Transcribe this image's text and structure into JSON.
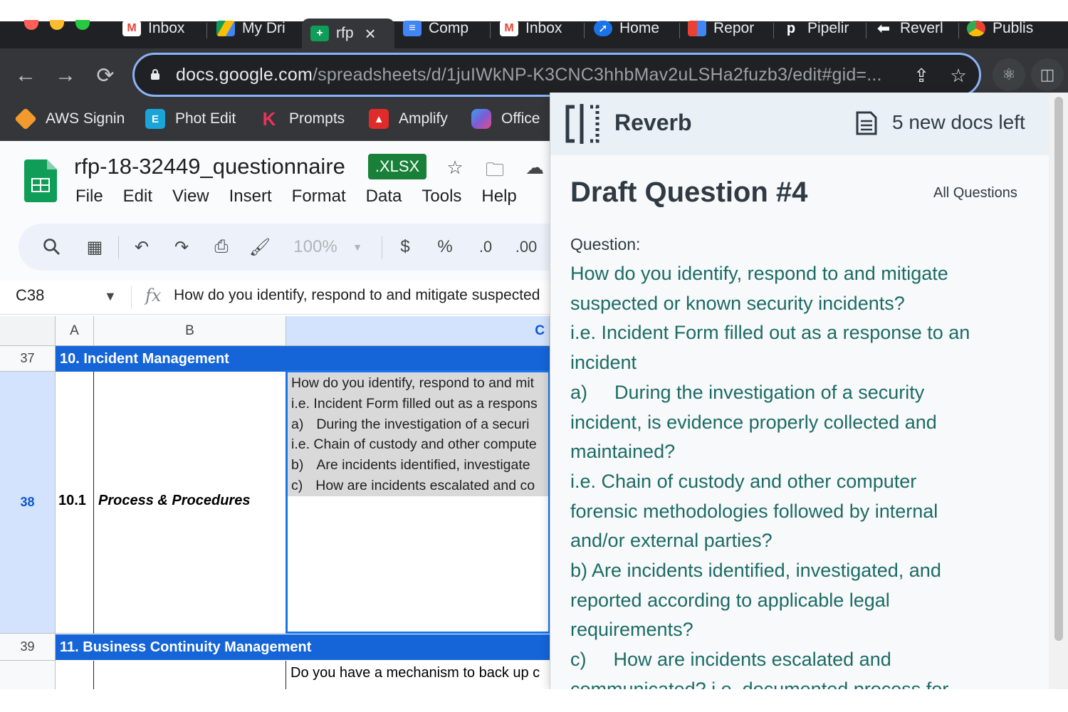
{
  "browser": {
    "tabs": [
      {
        "label": "Inbox",
        "icon": "gmail-icon"
      },
      {
        "label": "My Dri",
        "icon": "drive-icon"
      },
      {
        "label": "rfp",
        "icon": "sheets-icon",
        "close": "×"
      },
      {
        "label": "Comp",
        "icon": "docs-icon"
      },
      {
        "label": "Inbox",
        "icon": "gmail-icon"
      },
      {
        "label": "Home",
        "icon": "compass-icon"
      },
      {
        "label": "Repor",
        "icon": "report-icon"
      },
      {
        "label": "Pipelir",
        "icon": "p-icon"
      },
      {
        "label": "Reverl",
        "icon": "reverb-icon"
      },
      {
        "label": "Publis",
        "icon": "chrome-icon"
      }
    ],
    "url_host": "docs.google.com",
    "url_path": "/spreadsheets/d/1juIWkNP-K3CNC3hhbMav2uLSHa2fuzb3/edit#gid=...",
    "bookmarks": [
      {
        "label": "AWS Signin",
        "color": "#f29a2e"
      },
      {
        "label": "Phot Edit",
        "color": "#1aa5d8"
      },
      {
        "label": "Prompts",
        "color": "#e8345b"
      },
      {
        "label": "Amplify",
        "color": "#e02b2b"
      },
      {
        "label": "Office",
        "color": "#7b5cd6"
      }
    ]
  },
  "sheets": {
    "title": "rfp-18-32449_questionnaire",
    "badge": ".XLSX",
    "menu": [
      "File",
      "Edit",
      "View",
      "Insert",
      "Format",
      "Data",
      "Tools",
      "Help"
    ],
    "zoom": "100%",
    "currency": "$",
    "percent": "%",
    "dec_decrease": ".0",
    "dec_increase": ".00",
    "name_box": "C38",
    "fx": "fx",
    "formula": "How do you identify, respond to and mitigate suspected",
    "columns": [
      "A",
      "B",
      "C"
    ],
    "rows": [
      {
        "num": "37",
        "section": "10.  Incident Management"
      },
      {
        "num": "38",
        "a": "10.1",
        "b": "Process & Procedures"
      },
      {
        "num": "39",
        "section": "11.  Business Continuity Management"
      }
    ],
    "c38_lines": [
      {
        "tag": "",
        "text": "How do you identify, respond to and mit"
      },
      {
        "tag": "",
        "text": "i.e. Incident Form filled out as a respons"
      },
      {
        "tag": "a)",
        "text": "During the investigation of a securi"
      },
      {
        "tag": "",
        "text": "i.e. Chain of custody and other compute"
      },
      {
        "tag": "b)",
        "text": "Are incidents identified, investigate"
      },
      {
        "tag": "c)",
        "text": "How are incidents escalated and co"
      }
    ],
    "c40_text": "Do you have a mechanism to back up c"
  },
  "reverb": {
    "brand": "Reverb",
    "docs_left": "5 new docs left",
    "title": "Draft Question #4",
    "all_questions": "All Questions",
    "question_label": "Question:",
    "lines": [
      "How do you identify, respond to and mitigate",
      "suspected or known security incidents?",
      "i.e. Incident Form filled out as a response to an",
      "incident",
      "a)\tDuring the investigation of a security",
      "incident, is evidence properly collected and",
      "maintained?",
      "i.e. Chain of custody and other computer",
      "forensic methodologies followed by internal",
      "and/or external parties?",
      "b) Are incidents identified, investigated, and",
      "reported according to applicable legal",
      "requirements?",
      "c)\tHow are incidents escalated and",
      "communicated? i.e. documented process for"
    ]
  }
}
